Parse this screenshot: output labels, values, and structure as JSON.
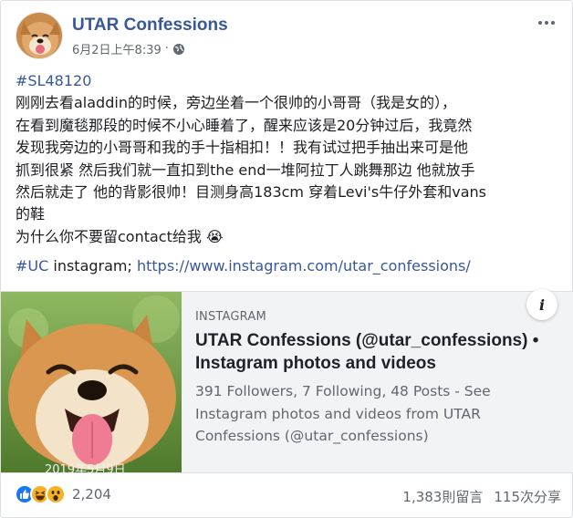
{
  "post": {
    "page_name": "UTAR Confessions",
    "timestamp": "6月2日上午8:39",
    "separator": "·",
    "privacy_icon": "globe-icon",
    "more_icon": "more-options-icon"
  },
  "text": {
    "hashtag_id": "#SL48120",
    "lines": [
      "刚刚去看aladdin的时候，旁边坐着一个很帅的小哥哥（我是女的），",
      "在看到魔毯那段的时候不小心睡着了，醒来应该是20分钟过后，我竟然",
      "发现我旁边的小哥哥和我的手十指相扣！！我有试过把手抽出来可是他",
      "抓到很紧 然后我们就一直扣到the end一堆阿拉丁人跳舞那边 他就放手",
      "然后就走了 他的背影很帅！目测身高183cm 穿着Levi's牛仔外套和vans",
      "的鞋"
    ],
    "last_line": "为什么你不要留contact给我",
    "emoji": "😭",
    "footer_hashtag": "#UC",
    "footer_text": " instagram; ",
    "link": "https://www.instagram.com/utar_confessions/"
  },
  "preview": {
    "domain": "INSTAGRAM",
    "title": "UTAR Confessions (@utar_confessions) • Instagram photos and videos",
    "description": "391 Followers, 7 Following, 48 Posts - See Instagram photos and videos from UTAR Confessions (@utar_confessions)",
    "image_caption": "2019年5月9日",
    "info_icon": "i"
  },
  "footer": {
    "reaction_icons": [
      "like-icon",
      "haha-icon",
      "wow-icon"
    ],
    "reaction_count": "2,204",
    "comments": "1,383則留言",
    "shares": "115次分享"
  },
  "colors": {
    "link_blue": "#385898",
    "like_blue": "#1877f2",
    "emoji_yellow": "#f7b125"
  }
}
